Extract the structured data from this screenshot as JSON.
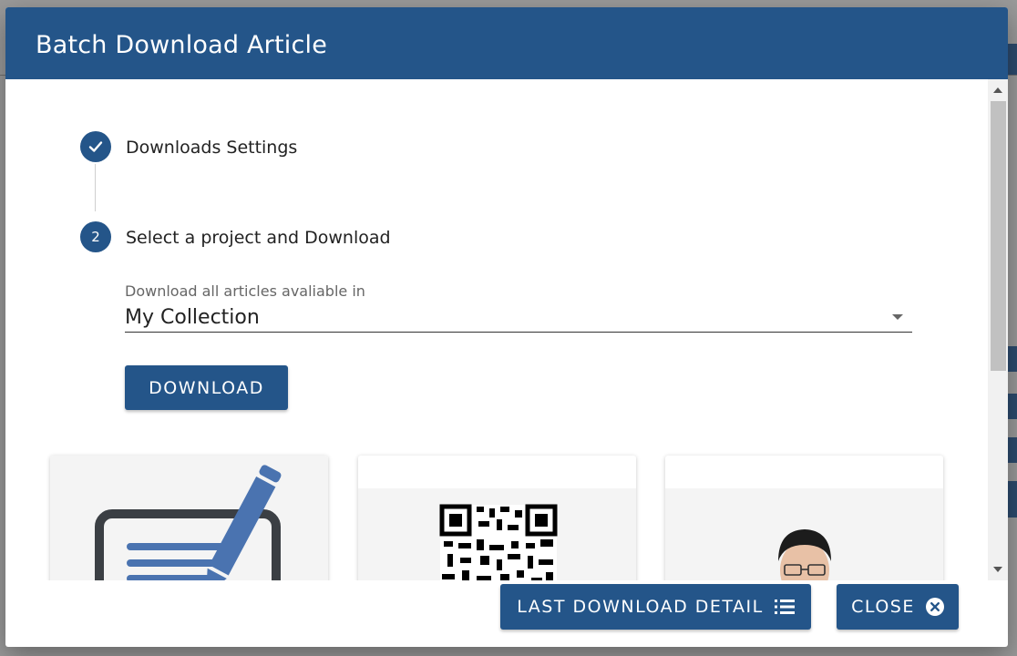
{
  "dialog": {
    "title": "Batch Download Article"
  },
  "stepper": {
    "steps": [
      {
        "label": "Downloads Settings",
        "state": "completed",
        "icon": "check-icon"
      },
      {
        "number": "2",
        "label": "Select a project and Download",
        "state": "active"
      }
    ]
  },
  "form": {
    "field_label": "Download all articles avaliable in",
    "selected_value": "My Collection",
    "download_label": "DOWNLOAD"
  },
  "cards": [
    {
      "image": "pencil-document-icon"
    },
    {
      "image": "qr-code-icon"
    },
    {
      "image": "avatar-photo"
    }
  ],
  "footer": {
    "last_download_label": "LAST DOWNLOAD DETAIL",
    "last_download_icon": "list-icon",
    "close_label": "CLOSE",
    "close_icon": "close-circle-icon"
  },
  "colors": {
    "primary": "#245589",
    "overlay": "#8a8a8a"
  }
}
